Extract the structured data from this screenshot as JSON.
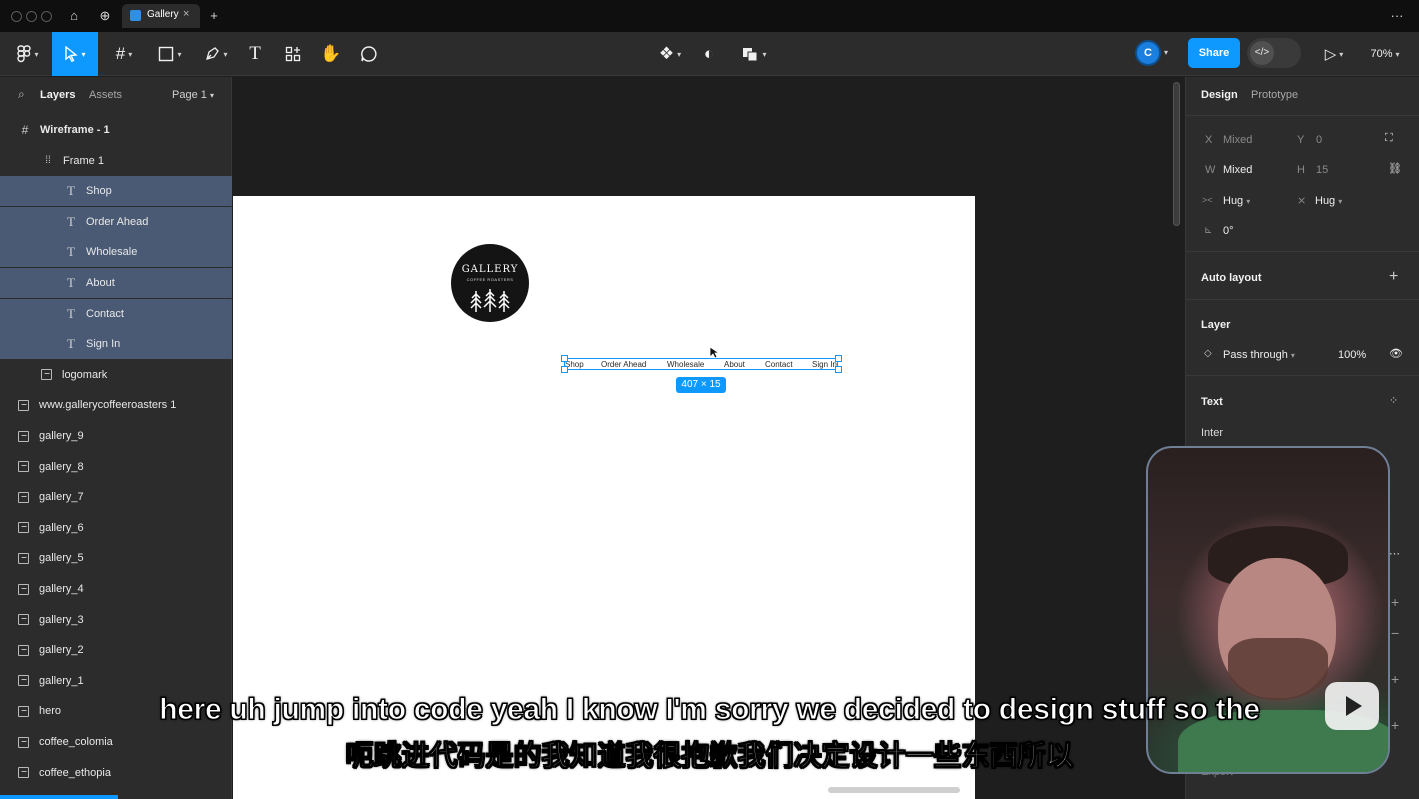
{
  "tab": {
    "title": "Gallery",
    "close": "×",
    "new": "+"
  },
  "titlebar": {
    "more": "···"
  },
  "toolbar": {
    "zoom": "70%",
    "share_label": "Share",
    "avatar_initial": "C",
    "devmode_icon": "</>",
    "tools": [
      "figma-menu-icon",
      "move-tool-icon",
      "frame-tool-icon",
      "shape-tool-icon",
      "pen-tool-icon",
      "text-tool-icon",
      "resources-icon",
      "hand-tool-icon",
      "comment-icon"
    ],
    "active_tool": "move-tool-icon"
  },
  "left_panel": {
    "tabs": {
      "layers": "Layers",
      "assets": "Assets",
      "page": "Page 1"
    },
    "layers": [
      {
        "name": "Wireframe - 1",
        "type": "frame",
        "indent": 0,
        "selected": false,
        "bold": true
      },
      {
        "name": "Frame 1",
        "type": "autolayout",
        "indent": 1,
        "selected": false
      },
      {
        "name": "Shop",
        "type": "text",
        "indent": 2,
        "selected": true
      },
      {
        "name": "Order Ahead",
        "type": "text",
        "indent": 2,
        "selected": true
      },
      {
        "name": "Wholesale",
        "type": "text",
        "indent": 2,
        "selected": true
      },
      {
        "name": "About",
        "type": "text",
        "indent": 2,
        "selected": true
      },
      {
        "name": "Contact",
        "type": "text",
        "indent": 2,
        "selected": true
      },
      {
        "name": "Sign In",
        "type": "text",
        "indent": 2,
        "selected": true
      },
      {
        "name": "logomark",
        "type": "image",
        "indent": 1,
        "selected": false
      },
      {
        "name": "www.gallerycoffeeroasters 1",
        "type": "image",
        "indent": 0,
        "selected": false
      },
      {
        "name": "gallery_9",
        "type": "image",
        "indent": 0,
        "selected": false
      },
      {
        "name": "gallery_8",
        "type": "image",
        "indent": 0,
        "selected": false
      },
      {
        "name": "gallery_7",
        "type": "image",
        "indent": 0,
        "selected": false
      },
      {
        "name": "gallery_6",
        "type": "image",
        "indent": 0,
        "selected": false
      },
      {
        "name": "gallery_5",
        "type": "image",
        "indent": 0,
        "selected": false
      },
      {
        "name": "gallery_4",
        "type": "image",
        "indent": 0,
        "selected": false
      },
      {
        "name": "gallery_3",
        "type": "image",
        "indent": 0,
        "selected": false
      },
      {
        "name": "gallery_2",
        "type": "image",
        "indent": 0,
        "selected": false
      },
      {
        "name": "gallery_1",
        "type": "image",
        "indent": 0,
        "selected": false
      },
      {
        "name": "hero",
        "type": "image",
        "indent": 0,
        "selected": false
      },
      {
        "name": "coffee_colomia",
        "type": "image",
        "indent": 0,
        "selected": false
      },
      {
        "name": "coffee_ethopia",
        "type": "image",
        "indent": 0,
        "selected": false
      }
    ]
  },
  "canvas": {
    "logo_text": "GALLERY",
    "logo_sub": "COFFEE ROASTERS",
    "nav_items": [
      "Shop",
      "Order Ahead",
      "Wholesale",
      "About",
      "Contact",
      "Sign In"
    ],
    "selection_size": "407 × 15"
  },
  "right_panel": {
    "tabs": {
      "design": "Design",
      "prototype": "Prototype"
    },
    "x_label": "X",
    "x_value": "Mixed",
    "y_label": "Y",
    "y_value": "0",
    "w_label": "W",
    "w_value": "Mixed",
    "h_label": "H",
    "h_value": "15",
    "hug_w": "Hug",
    "hug_h": "Hug",
    "rotation": "0°",
    "auto_layout": "Auto layout",
    "layer_title": "Layer",
    "blend_mode": "Pass through",
    "opacity": "100%",
    "text_title": "Text",
    "font": "Inter",
    "export": "Export"
  },
  "subtitles": {
    "en": "here uh jump into code yeah I know I'm sorry we decided to design stuff so the",
    "zh": "呃跳进代码是的我知道我很抱歉我们决定设计一些东西所以"
  }
}
